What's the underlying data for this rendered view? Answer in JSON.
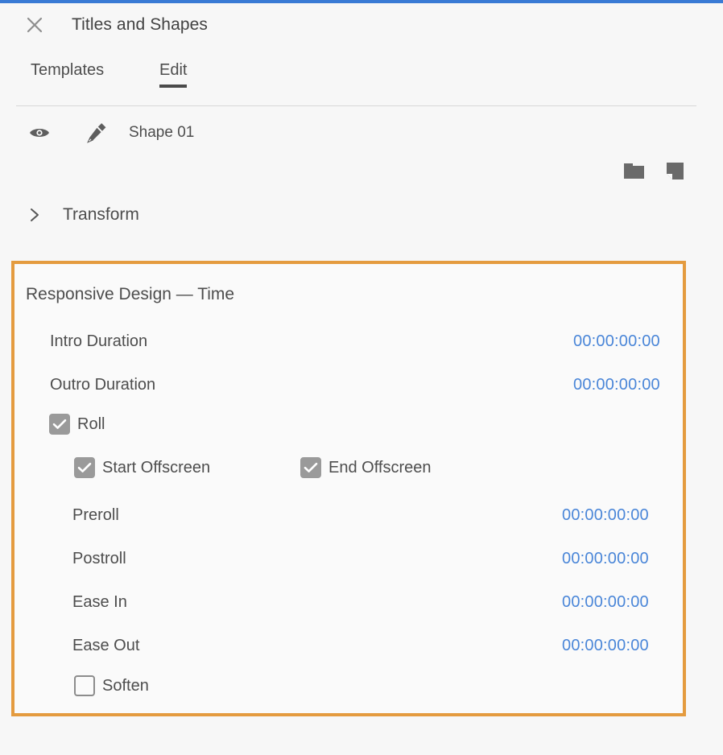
{
  "window": {
    "accent_bar_color": "#3a7bd5",
    "title": "Titles and Shapes",
    "close_icon": "close-icon"
  },
  "tabs": {
    "items": [
      {
        "label": "Templates",
        "active": false
      },
      {
        "label": "Edit",
        "active": true
      }
    ]
  },
  "layer": {
    "visibility_icon": "eye-icon",
    "type_icon": "pen-tool-icon",
    "name": "Shape 01",
    "actions": [
      {
        "icon": "new-group-folder-icon",
        "name": "new-group-button"
      },
      {
        "icon": "new-layer-icon",
        "name": "new-layer-button"
      }
    ]
  },
  "transform": {
    "chevron_icon": "chevron-right-icon",
    "label": "Transform",
    "expanded": false
  },
  "responsive_design": {
    "highlight_color": "#e49b3f",
    "title": "Responsive Design — Time",
    "intro_duration": {
      "label": "Intro Duration",
      "value": "00:00:00:00"
    },
    "outro_duration": {
      "label": "Outro Duration",
      "value": "00:00:00:00"
    },
    "roll": {
      "label": "Roll",
      "checked": true
    },
    "start_offscreen": {
      "label": "Start Offscreen",
      "checked": true
    },
    "end_offscreen": {
      "label": "End Offscreen",
      "checked": true
    },
    "preroll": {
      "label": "Preroll",
      "value": "00:00:00:00"
    },
    "postroll": {
      "label": "Postroll",
      "value": "00:00:00:00"
    },
    "ease_in": {
      "label": "Ease In",
      "value": "00:00:00:00"
    },
    "ease_out": {
      "label": "Ease Out",
      "value": "00:00:00:00"
    },
    "soften": {
      "label": "Soften",
      "checked": false
    },
    "value_color": "#4a86d8"
  }
}
